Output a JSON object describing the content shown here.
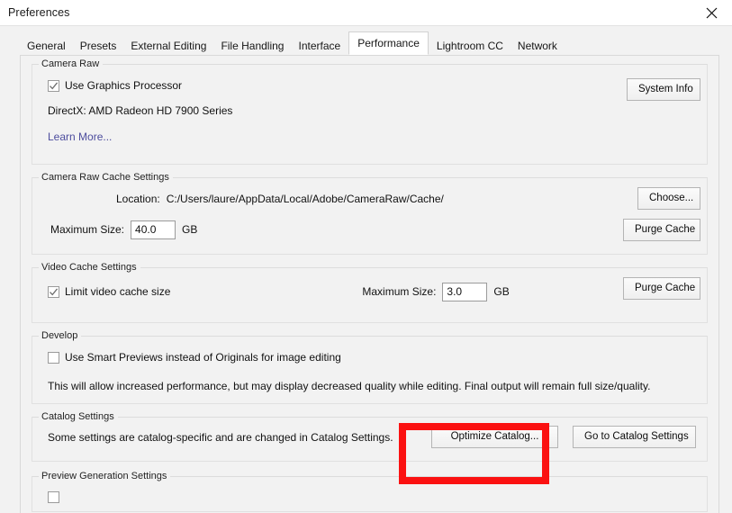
{
  "window": {
    "title": "Preferences",
    "close_label": "Close"
  },
  "tabs": [
    {
      "label": "General",
      "selected": false
    },
    {
      "label": "Presets",
      "selected": false
    },
    {
      "label": "External Editing",
      "selected": false
    },
    {
      "label": "File Handling",
      "selected": false
    },
    {
      "label": "Interface",
      "selected": false
    },
    {
      "label": "Performance",
      "selected": true
    },
    {
      "label": "Lightroom CC",
      "selected": false
    },
    {
      "label": "Network",
      "selected": false
    }
  ],
  "groups": {
    "camera_raw": {
      "title": "Camera Raw",
      "use_gpu_label": "Use Graphics Processor",
      "use_gpu_checked": true,
      "gpu_info": "DirectX: AMD Radeon HD 7900 Series",
      "learn_more": "Learn More...",
      "system_info_button": "System Info"
    },
    "camera_raw_cache": {
      "title": "Camera Raw Cache Settings",
      "location_label": "Location:",
      "location_value": "C:/Users/laure/AppData/Local/Adobe/CameraRaw/Cache/",
      "max_size_label": "Maximum Size:",
      "max_size_value": "40.0",
      "unit": "GB",
      "choose_button": "Choose...",
      "purge_button": "Purge Cache"
    },
    "video_cache": {
      "title": "Video Cache Settings",
      "limit_label": "Limit video cache size",
      "limit_checked": true,
      "max_size_label": "Maximum Size:",
      "max_size_value": "3.0",
      "unit": "GB",
      "purge_button": "Purge Cache"
    },
    "develop": {
      "title": "Develop",
      "smart_previews_label": "Use Smart Previews instead of Originals for image editing",
      "smart_previews_checked": false,
      "note": "This will allow increased performance, but may display decreased quality while editing. Final output will remain full size/quality."
    },
    "catalog": {
      "title": "Catalog Settings",
      "description": "Some settings are catalog-specific and are changed in Catalog Settings.",
      "optimize_button": "Optimize Catalog...",
      "goto_button": "Go to Catalog Settings"
    },
    "preview_generation": {
      "title": "Preview Generation Settings"
    }
  },
  "highlight": {
    "color": "#fb1111",
    "target": "optimize-catalog-button"
  }
}
